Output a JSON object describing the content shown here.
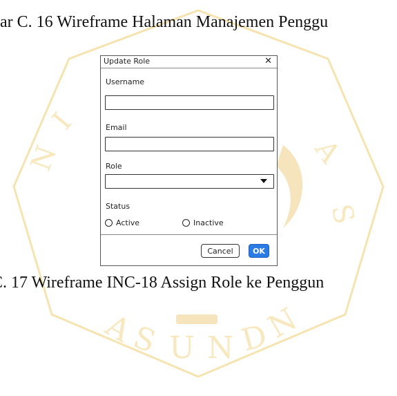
{
  "captions": {
    "top": "bar C. 16 Wireframe Halaman Manajemen Penggu",
    "bottom": "C. 17 Wireframe INC-18 Assign Role ke Penggun"
  },
  "watermark": {
    "letters": [
      "P",
      "A",
      "S",
      "U",
      "N",
      "D",
      "A",
      "N"
    ],
    "color": "#f5e3ad"
  },
  "dialog": {
    "title": "Update Role",
    "close_icon": "close-icon",
    "username_label": "Username",
    "username_value": "",
    "email_label": "Email",
    "email_value": "",
    "role_label": "Role",
    "role_value": "",
    "status_label": "Status",
    "status_options": [
      "Active",
      "Inactive"
    ],
    "cancel_label": "Cancel",
    "ok_label": "OK",
    "ok_color": "#2a7be4"
  }
}
